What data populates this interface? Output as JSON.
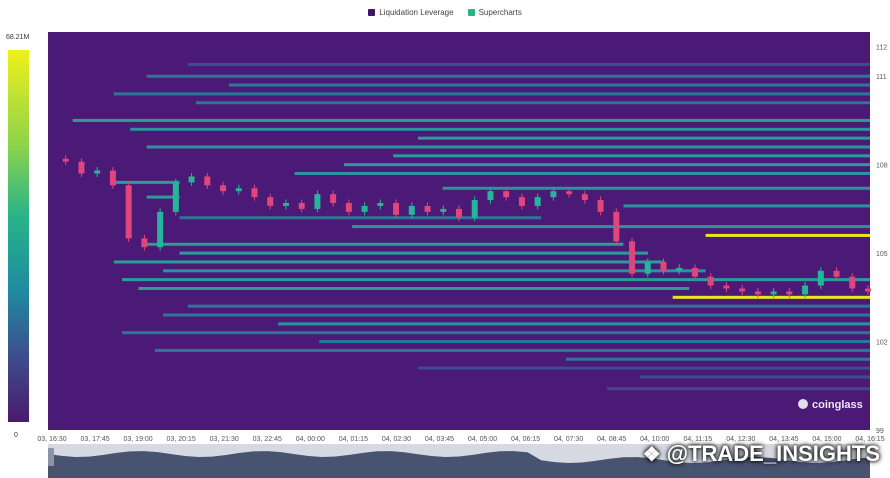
{
  "legend": [
    {
      "label": "Liquidation Leverage",
      "color": "#3d1466"
    },
    {
      "label": "Supercharts",
      "color": "#27b38a"
    }
  ],
  "colorbar": {
    "max_label": "68.21M",
    "min_label": "0"
  },
  "watermark": "coinglass",
  "brand": {
    "text": "@TRADE_INSIGHTS",
    "icon": "binance-diamond-icon"
  },
  "colors": {
    "background": "#4b1a76",
    "candle_up": "#26b49a",
    "candle_down": "#e0457b",
    "band_low": "#3c4f8e",
    "band_mid": "#2a9a9c",
    "band_high": "#f0f01a"
  },
  "chart_data": {
    "type": "heatmap",
    "title": "",
    "x_ticks": [
      "03, 16:30",
      "03, 17:45",
      "03, 19:00",
      "03, 20:15",
      "03, 21:30",
      "03, 22:45",
      "04, 00:00",
      "04, 01:15",
      "04, 02:30",
      "04, 03:45",
      "04, 05:00",
      "04, 06:15",
      "04, 07:30",
      "04, 08:45",
      "04, 10:00",
      "04, 11:15",
      "04, 12:30",
      "04, 13:45",
      "04, 15:00",
      "04, 16:15"
    ],
    "y_ticks": [
      "112",
      "111",
      "108",
      "105",
      "102",
      "99"
    ],
    "ylim": [
      99,
      112.5
    ],
    "price_path": [
      [
        0,
        108.2
      ],
      [
        1,
        108.1
      ],
      [
        2,
        107.7
      ],
      [
        3,
        107.8
      ],
      [
        4,
        107.3
      ],
      [
        5,
        105.5
      ],
      [
        6,
        105.2
      ],
      [
        7,
        106.4
      ],
      [
        8,
        107.4
      ],
      [
        9,
        107.6
      ],
      [
        10,
        107.3
      ],
      [
        11,
        107.1
      ],
      [
        12,
        107.2
      ],
      [
        13,
        106.9
      ],
      [
        14,
        106.6
      ],
      [
        15,
        106.7
      ],
      [
        16,
        106.5
      ],
      [
        17,
        107.0
      ],
      [
        18,
        106.7
      ],
      [
        19,
        106.4
      ],
      [
        20,
        106.6
      ],
      [
        21,
        106.7
      ],
      [
        22,
        106.3
      ],
      [
        23,
        106.6
      ],
      [
        24,
        106.4
      ],
      [
        25,
        106.5
      ],
      [
        26,
        106.2
      ],
      [
        27,
        106.8
      ],
      [
        28,
        107.1
      ],
      [
        29,
        106.9
      ],
      [
        30,
        106.6
      ],
      [
        31,
        106.9
      ],
      [
        32,
        107.1
      ],
      [
        33,
        107.0
      ],
      [
        34,
        106.8
      ],
      [
        35,
        106.4
      ],
      [
        36,
        105.4
      ],
      [
        37,
        104.3
      ],
      [
        38,
        104.7
      ],
      [
        39,
        104.4
      ],
      [
        40,
        104.5
      ],
      [
        41,
        104.2
      ],
      [
        42,
        103.9
      ],
      [
        43,
        103.8
      ],
      [
        44,
        103.7
      ],
      [
        45,
        103.6
      ],
      [
        46,
        103.7
      ],
      [
        47,
        103.6
      ],
      [
        48,
        103.9
      ],
      [
        49,
        104.4
      ],
      [
        50,
        104.2
      ],
      [
        51,
        103.8
      ],
      [
        52,
        103.7
      ]
    ],
    "bands": [
      {
        "y": 111.4,
        "x0": 0.17,
        "x1": 1,
        "level": 0.25
      },
      {
        "y": 111.0,
        "x0": 0.12,
        "x1": 1,
        "level": 0.3
      },
      {
        "y": 110.7,
        "x0": 0.22,
        "x1": 1,
        "level": 0.35
      },
      {
        "y": 110.4,
        "x0": 0.08,
        "x1": 1,
        "level": 0.35
      },
      {
        "y": 110.1,
        "x0": 0.18,
        "x1": 1,
        "level": 0.3
      },
      {
        "y": 109.5,
        "x0": 0.03,
        "x1": 1,
        "level": 0.5
      },
      {
        "y": 109.2,
        "x0": 0.1,
        "x1": 1,
        "level": 0.4
      },
      {
        "y": 108.9,
        "x0": 0.45,
        "x1": 1,
        "level": 0.5
      },
      {
        "y": 108.6,
        "x0": 0.12,
        "x1": 1,
        "level": 0.45
      },
      {
        "y": 108.3,
        "x0": 0.42,
        "x1": 1,
        "level": 0.55
      },
      {
        "y": 108.0,
        "x0": 0.36,
        "x1": 1,
        "level": 0.5
      },
      {
        "y": 107.7,
        "x0": 0.3,
        "x1": 1,
        "level": 0.4
      },
      {
        "y": 107.4,
        "x0": 0.08,
        "x1": 0.16,
        "level": 0.6
      },
      {
        "y": 107.2,
        "x0": 0.48,
        "x1": 1,
        "level": 0.4
      },
      {
        "y": 106.9,
        "x0": 0.12,
        "x1": 0.16,
        "level": 0.7
      },
      {
        "y": 106.6,
        "x0": 0.7,
        "x1": 1,
        "level": 0.45
      },
      {
        "y": 106.2,
        "x0": 0.16,
        "x1": 0.6,
        "level": 0.35
      },
      {
        "y": 105.9,
        "x0": 0.37,
        "x1": 1,
        "level": 0.45
      },
      {
        "y": 105.6,
        "x0": 0.8,
        "x1": 1,
        "level": 1.0
      },
      {
        "y": 105.3,
        "x0": 0.12,
        "x1": 0.7,
        "level": 0.55
      },
      {
        "y": 105.0,
        "x0": 0.16,
        "x1": 0.73,
        "level": 0.6
      },
      {
        "y": 104.7,
        "x0": 0.08,
        "x1": 0.75,
        "level": 0.5
      },
      {
        "y": 104.4,
        "x0": 0.14,
        "x1": 0.8,
        "level": 0.45
      },
      {
        "y": 104.1,
        "x0": 0.09,
        "x1": 1,
        "level": 0.5
      },
      {
        "y": 103.8,
        "x0": 0.11,
        "x1": 0.78,
        "level": 0.55
      },
      {
        "y": 103.5,
        "x0": 0.76,
        "x1": 1,
        "level": 1.0
      },
      {
        "y": 103.2,
        "x0": 0.17,
        "x1": 1,
        "level": 0.35
      },
      {
        "y": 102.9,
        "x0": 0.14,
        "x1": 1,
        "level": 0.3
      },
      {
        "y": 102.6,
        "x0": 0.28,
        "x1": 1,
        "level": 0.4
      },
      {
        "y": 102.3,
        "x0": 0.09,
        "x1": 1,
        "level": 0.3
      },
      {
        "y": 102.0,
        "x0": 0.33,
        "x1": 1,
        "level": 0.35
      },
      {
        "y": 101.7,
        "x0": 0.13,
        "x1": 1,
        "level": 0.3
      },
      {
        "y": 101.4,
        "x0": 0.63,
        "x1": 1,
        "level": 0.3
      },
      {
        "y": 101.1,
        "x0": 0.45,
        "x1": 1,
        "level": 0.25
      },
      {
        "y": 100.8,
        "x0": 0.72,
        "x1": 1,
        "level": 0.25
      },
      {
        "y": 100.4,
        "x0": 0.68,
        "x1": 1,
        "level": 0.2
      }
    ]
  }
}
